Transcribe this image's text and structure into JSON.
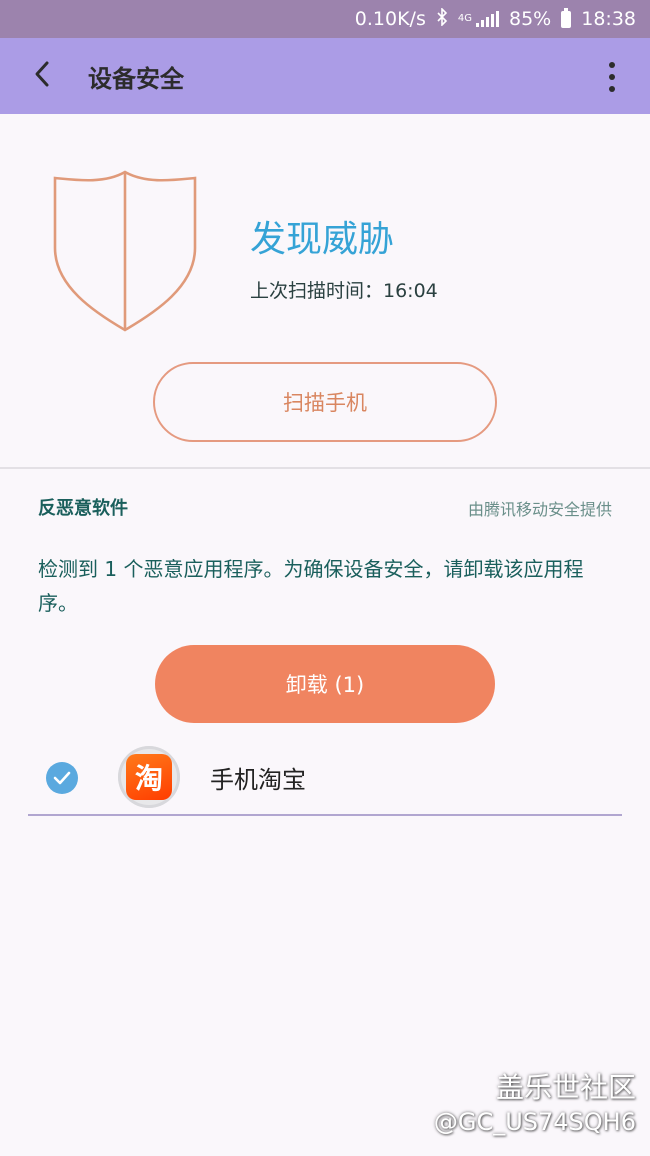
{
  "status_bar": {
    "net_speed": "0.10K/s",
    "network_type": "4G",
    "battery": "85%",
    "time": "18:38"
  },
  "app_bar": {
    "title": "设备安全"
  },
  "status_card": {
    "threat_title": "发现威胁",
    "last_scan_label": "上次扫描时间：16:04",
    "scan_button": "扫描手机"
  },
  "anti_malware": {
    "section_title": "反恶意软件",
    "provider": "由腾讯移动安全提供",
    "message": "检测到 1 个恶意应用程序。为确保设备安全，请卸载该应用程序。",
    "uninstall_button": "卸载 (1)",
    "apps": [
      {
        "name": "手机淘宝",
        "icon_glyph": "淘",
        "checked": true
      }
    ]
  },
  "watermark": {
    "line1": "盖乐世社区",
    "line2": "@GC_US74SQH6"
  },
  "colors": {
    "status_bar": "#9c83ad",
    "app_bar": "#ab9ce6",
    "accent_blue": "#35a3d6",
    "shield_stroke": "#e09a7a",
    "uninstall": "#f08460",
    "text_teal": "#1a5f5c"
  }
}
